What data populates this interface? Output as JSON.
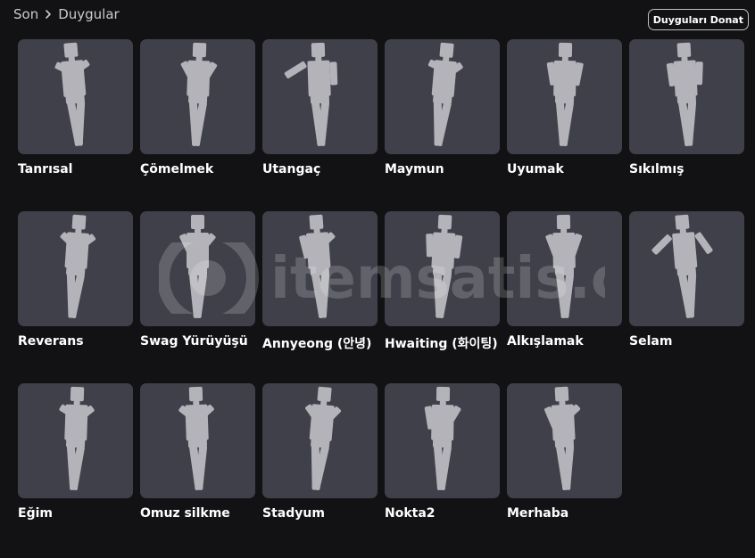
{
  "breadcrumb": {
    "root": "Son",
    "current": "Duygular"
  },
  "equip_button": "Duyguları Donat",
  "watermark": {
    "text": "itemsatis",
    "domain": ".com"
  },
  "emotes": [
    {
      "label": "Tanrısal",
      "icon": "emote-pose-icon"
    },
    {
      "label": "Çömelmek",
      "icon": "emote-pose-icon"
    },
    {
      "label": "Utangaç",
      "icon": "emote-pose-icon"
    },
    {
      "label": "Maymun",
      "icon": "emote-pose-icon"
    },
    {
      "label": "Uyumak",
      "icon": "emote-pose-icon"
    },
    {
      "label": "Sıkılmış",
      "icon": "emote-pose-icon"
    },
    {
      "label": "Reverans",
      "icon": "emote-pose-icon"
    },
    {
      "label": "Swag Yürüyüşü",
      "icon": "emote-pose-icon"
    },
    {
      "label": "Annyeong (안녕)",
      "icon": "emote-pose-icon"
    },
    {
      "label": "Hwaiting (화이팅)",
      "icon": "emote-pose-icon"
    },
    {
      "label": "Alkışlamak",
      "icon": "emote-pose-icon"
    },
    {
      "label": "Selam",
      "icon": "emote-pose-icon"
    },
    {
      "label": "Eğim",
      "icon": "emote-pose-icon"
    },
    {
      "label": "Omuz silkme",
      "icon": "emote-pose-icon"
    },
    {
      "label": "Stadyum",
      "icon": "emote-pose-icon"
    },
    {
      "label": "Nokta2",
      "icon": "emote-pose-icon"
    },
    {
      "label": "Merhaba",
      "icon": "emote-pose-icon"
    }
  ]
}
